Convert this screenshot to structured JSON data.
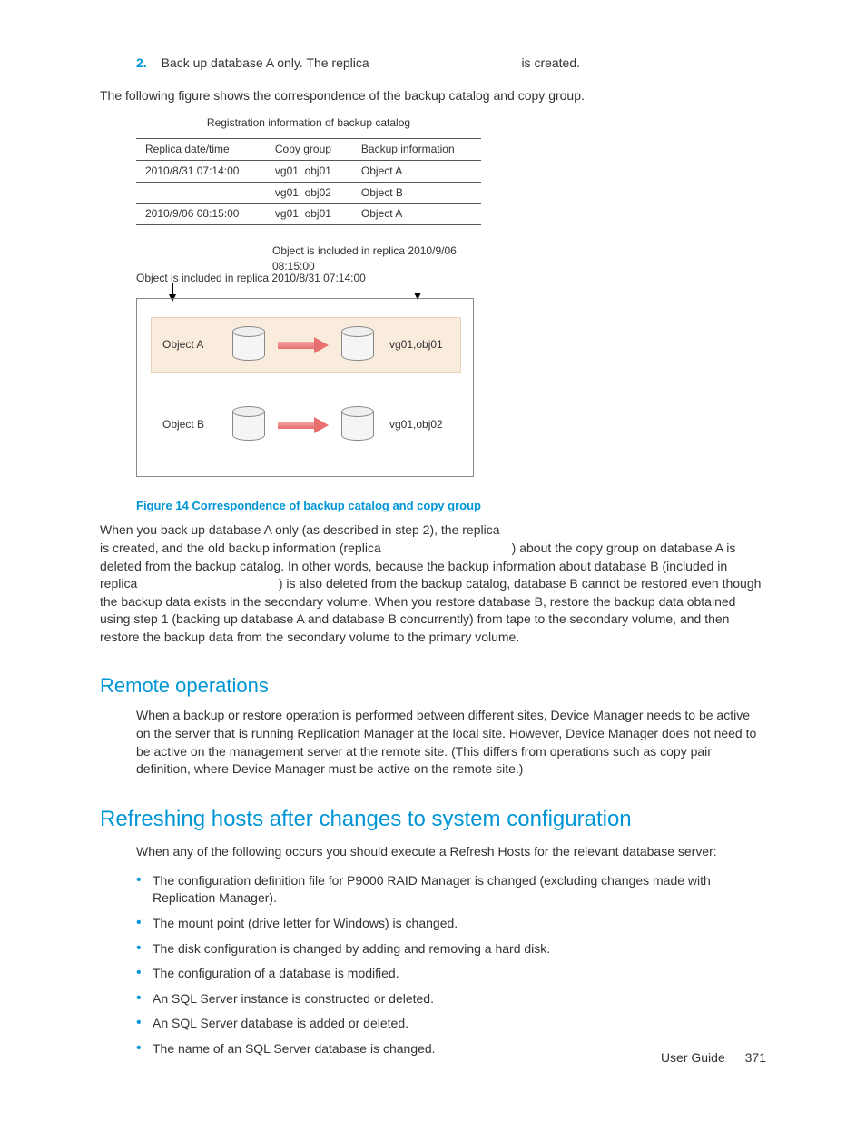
{
  "step": {
    "num": "2.",
    "text_a": "Back up database A only. The replica ",
    "text_b": " is created."
  },
  "intro_para": "The following figure shows the correspondence of the backup catalog and copy group.",
  "table": {
    "title": "Registration information of backup catalog",
    "headers": [
      "Replica date/time",
      "Copy group",
      "Backup information"
    ],
    "rows": [
      [
        "2010/8/31 07:14:00",
        "vg01, obj01",
        "Object A"
      ],
      [
        "",
        "vg01, obj02",
        "Object B"
      ],
      [
        "2010/9/06 08:15:00",
        "vg01, obj01",
        "Object A"
      ]
    ]
  },
  "diagram": {
    "caption_right": "Object is included in replica 2010/9/06 08:15:00",
    "caption_left": "Object is included in replica 2010/8/31 07:14:00",
    "obj_a": "Object A",
    "obj_b": "Object B",
    "vg1": "vg01,obj01",
    "vg2": "vg01,obj02"
  },
  "figure_caption": "Figure 14 Correspondence of backup catalog and copy group",
  "explain": {
    "l1": "When you back up database A only (as described in step 2), the replica ",
    "l2": "is created, and the old backup information (replica ",
    "l2b": ") about the copy group",
    "l3": " on database A is deleted from the backup catalog. In other words, because the backup information about database B (included in replica ",
    "l3b": ") is also deleted from the backup catalog, database B cannot be restored even though the backup data exists in the secondary volume. When you restore database B, restore the backup data obtained using step 1 (backing up database A and database B concurrently) from tape to the secondary volume, and then restore the backup data from the secondary volume to the primary volume.",
    "gap1": "                                   ",
    "gap2": "                                      "
  },
  "remote": {
    "heading": "Remote operations",
    "para": "When a backup or restore operation is performed between different sites, Device Manager needs to be active on the server that is running Replication Manager at the local site. However, Device Manager does not need to be active on the management server at the remote site. (This differs from operations such as copy pair definition, where Device Manager must be active on the remote site.)"
  },
  "refresh": {
    "heading": "Refreshing hosts after changes to system configuration",
    "intro": "When any of the following occurs you should execute a Refresh Hosts for the relevant database server:",
    "items": [
      "The configuration definition file for P9000 RAID Manager is changed (excluding changes made with Replication Manager).",
      "The mount point (drive letter for Windows) is changed.",
      "The disk configuration is changed by adding and removing a hard disk.",
      "The configuration of a database is modified.",
      "An SQL Server instance is constructed or deleted.",
      "An SQL Server database is added or deleted.",
      "The name of an SQL Server database is changed."
    ]
  },
  "footer": {
    "label": "User Guide",
    "page": "371"
  }
}
